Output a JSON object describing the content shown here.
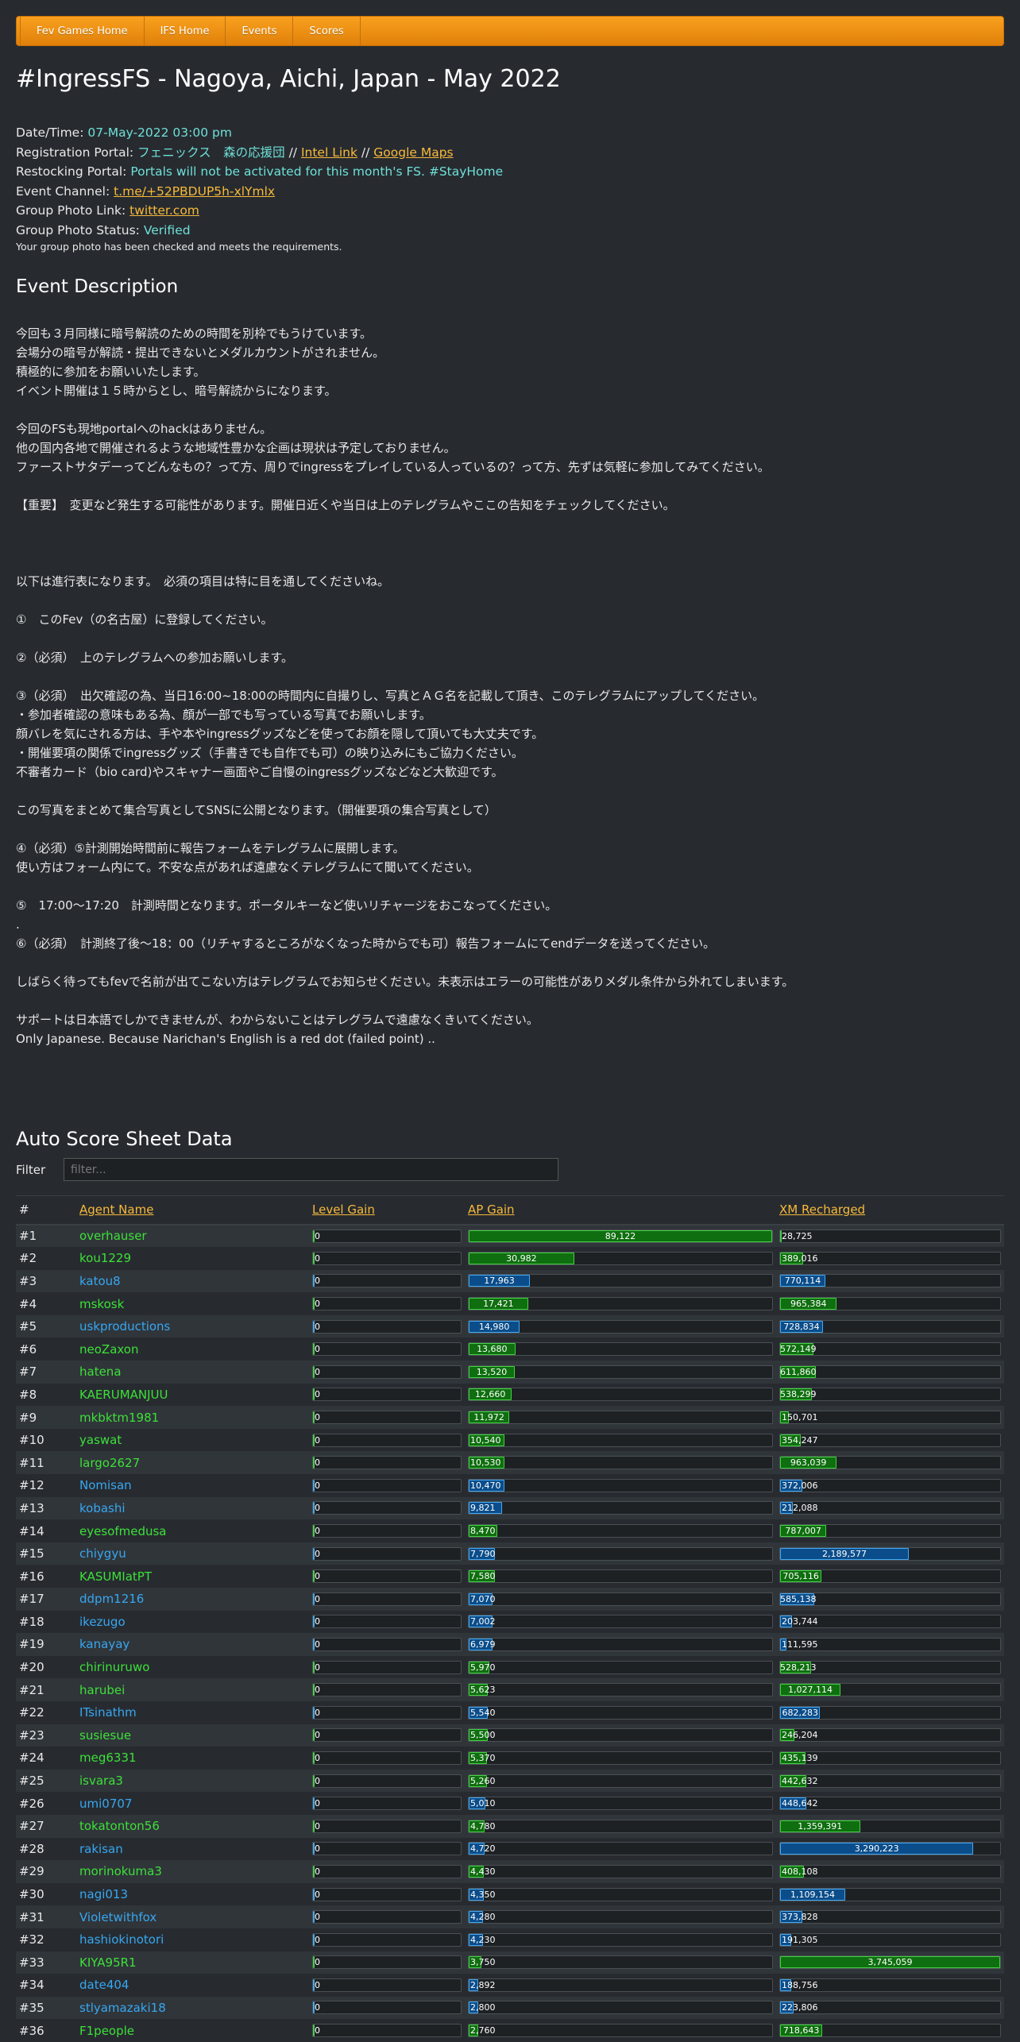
{
  "nav": [
    "Fev Games Home",
    "IFS Home",
    "Events",
    "Scores"
  ],
  "title": "#IngressFS - Nagoya, Aichi, Japan - May 2022",
  "info": {
    "datetime_label": "Date/Time:",
    "datetime_value": "07-May-2022 03:00 pm",
    "registration_label": "Registration Portal:",
    "registration_value": "フェニックス　森の応援団",
    "sep": " // ",
    "intel_link": "Intel Link",
    "google_maps": "Google Maps",
    "restocking_label": "Restocking Portal:",
    "restocking_value": "Portals will not be activated for this month's FS. #StayHome",
    "channel_label": "Event Channel:",
    "channel_value": "t.me/+52PBDUP5h-xlYmlx",
    "photo_link_label": "Group Photo Link:",
    "photo_link_value": "twitter.com",
    "photo_status_label": "Group Photo Status:",
    "photo_status_value": "Verified",
    "photo_note": "Your group photo has been checked and meets the requirements."
  },
  "description_heading": "Event Description",
  "description": "今回も３月同様に暗号解読のための時間を別枠でもうけています。\n会場分の暗号が解読・提出できないとメダルカウントがされません。\n積極的に参加をお願いいたします。\nイベント開催は１５時からとし、暗号解読からになります。\n\n今回のFSも現地portalへのhackはありません。\n他の国内各地で開催されるような地域性豊かな企画は現状は予定しておりません。\nファーストサタデーってどんなもの？って方、周りでingressをプレイしている人っているの？って方、先ずは気軽に参加してみてください。\n\n【重要】　変更など発生する可能性があります。開催日近くや当日は上のテレグラムやここの告知をチェックしてください。\n\n\n\n以下は進行表になります。　必須の項目は特に目を通してくださいね。\n\n①　このFev（の名古屋）に登録してください。\n\n②（必須）　上のテレグラムへの参加お願いします。\n\n③（必須）　出欠確認の為、当日16:00~18:00の時間内に自撮りし、写真とＡＧ名を記載して頂き、このテレグラムにアップしてください。\n・参加者確認の意味もある為、顔が一部でも写っている写真でお願いします。\n顔バレを気にされる方は、手や本やingressグッズなどを使ってお顔を隠して頂いても大丈夫です。\n・開催要項の関係でingressグッズ（手書きでも自作でも可）の映り込みにもご協力ください。\n不審者カード（bio card)やスキャナー画面やご自慢のingressグッズなどなど大歓迎です。\n\nこの写真をまとめて集合写真としてSNSに公開となります。（開催要項の集合写真として）\n\n④（必須）⑤計測開始時間前に報告フォームをテレグラムに展開します。\n使い方はフォーム内にて。不安な点があれば遠慮なくテレグラムにて聞いてください。\n\n⑤　17:00～17:20　計測時間となります。ポータルキーなど使いリチャージをおこなってください。\n.\n⑥（必須）　計測終了後～18：00（リチャするところがなくなった時からでも可）報告フォームにてendデータを送ってください。\n\nしばらく待ってもfevで名前が出てこない方はテレグラムでお知らせください。未表示はエラーの可能性がありメダル条件から外れてしまいます。\n\nサポートは日本語でしかできませんが、わからないことはテレグラムで遠慮なくきいてください。\nOnly Japanese. Because Narichan's English is a red dot (failed point) ..",
  "score_heading": "Auto Score Sheet Data",
  "filter_label": "Filter",
  "filter_placeholder": "filter...",
  "table_headers": {
    "rank": "#",
    "agent": "Agent Name",
    "level": "Level Gain",
    "ap": "AP Gain",
    "xm": "XM Recharged"
  },
  "max_ap": 89122,
  "max_xm": 3745059,
  "colors": {
    "enl": "#3de038",
    "res": "#37a7f0",
    "accent": "#f8b93a"
  },
  "rows": [
    {
      "rank": "#1",
      "agent": "overhauser",
      "faction": "enl",
      "level": "0",
      "ap": 89122,
      "ap_text": "89,122",
      "xm": 28725,
      "xm_text": "28,725"
    },
    {
      "rank": "#2",
      "agent": "kou1229",
      "faction": "enl",
      "level": "0",
      "ap": 30982,
      "ap_text": "30,982",
      "xm": 389016,
      "xm_text": "389,016"
    },
    {
      "rank": "#3",
      "agent": "katou8",
      "faction": "res",
      "level": "0",
      "ap": 17963,
      "ap_text": "17,963",
      "xm": 770114,
      "xm_text": "770,114"
    },
    {
      "rank": "#4",
      "agent": "mskosk",
      "faction": "enl",
      "level": "0",
      "ap": 17421,
      "ap_text": "17,421",
      "xm": 965384,
      "xm_text": "965,384"
    },
    {
      "rank": "#5",
      "agent": "uskproductions",
      "faction": "res",
      "level": "0",
      "ap": 14980,
      "ap_text": "14,980",
      "xm": 728834,
      "xm_text": "728,834"
    },
    {
      "rank": "#6",
      "agent": "neoZaxon",
      "faction": "enl",
      "level": "0",
      "ap": 13680,
      "ap_text": "13,680",
      "xm": 572149,
      "xm_text": "572,149"
    },
    {
      "rank": "#7",
      "agent": "hatena",
      "faction": "enl",
      "level": "0",
      "ap": 13520,
      "ap_text": "13,520",
      "xm": 611860,
      "xm_text": "611,860"
    },
    {
      "rank": "#8",
      "agent": "KAERUMANJUU",
      "faction": "enl",
      "level": "0",
      "ap": 12660,
      "ap_text": "12,660",
      "xm": 538299,
      "xm_text": "538,299"
    },
    {
      "rank": "#9",
      "agent": "mkbktm1981",
      "faction": "enl",
      "level": "0",
      "ap": 11972,
      "ap_text": "11,972",
      "xm": 150701,
      "xm_text": "150,701"
    },
    {
      "rank": "#10",
      "agent": "yaswat",
      "faction": "enl",
      "level": "0",
      "ap": 10540,
      "ap_text": "10,540",
      "xm": 354247,
      "xm_text": "354,247"
    },
    {
      "rank": "#11",
      "agent": "largo2627",
      "faction": "enl",
      "level": "0",
      "ap": 10530,
      "ap_text": "10,530",
      "xm": 963039,
      "xm_text": "963,039"
    },
    {
      "rank": "#12",
      "agent": "Nomisan",
      "faction": "res",
      "level": "0",
      "ap": 10470,
      "ap_text": "10,470",
      "xm": 372006,
      "xm_text": "372,006"
    },
    {
      "rank": "#13",
      "agent": "kobashi",
      "faction": "res",
      "level": "0",
      "ap": 9821,
      "ap_text": "9,821",
      "xm": 212088,
      "xm_text": "212,088"
    },
    {
      "rank": "#14",
      "agent": "eyesofmedusa",
      "faction": "enl",
      "level": "0",
      "ap": 8470,
      "ap_text": "8,470",
      "xm": 787007,
      "xm_text": "787,007"
    },
    {
      "rank": "#15",
      "agent": "chiygyu",
      "faction": "res",
      "level": "0",
      "ap": 7790,
      "ap_text": "7,790",
      "xm": 2189577,
      "xm_text": "2,189,577"
    },
    {
      "rank": "#16",
      "agent": "KASUMIatPT",
      "faction": "enl",
      "level": "0",
      "ap": 7580,
      "ap_text": "7,580",
      "xm": 705116,
      "xm_text": "705,116"
    },
    {
      "rank": "#17",
      "agent": "ddpm1216",
      "faction": "res",
      "level": "0",
      "ap": 7070,
      "ap_text": "7,070",
      "xm": 585138,
      "xm_text": "585,138"
    },
    {
      "rank": "#18",
      "agent": "ikezugo",
      "faction": "res",
      "level": "0",
      "ap": 7002,
      "ap_text": "7,002",
      "xm": 203744,
      "xm_text": "203,744"
    },
    {
      "rank": "#19",
      "agent": "kanayay",
      "faction": "res",
      "level": "0",
      "ap": 6979,
      "ap_text": "6,979",
      "xm": 111595,
      "xm_text": "111,595"
    },
    {
      "rank": "#20",
      "agent": "chirinuruwo",
      "faction": "enl",
      "level": "0",
      "ap": 5970,
      "ap_text": "5,970",
      "xm": 528213,
      "xm_text": "528,213"
    },
    {
      "rank": "#21",
      "agent": "harubei",
      "faction": "enl",
      "level": "0",
      "ap": 5623,
      "ap_text": "5,623",
      "xm": 1027114,
      "xm_text": "1,027,114"
    },
    {
      "rank": "#22",
      "agent": "ITsinathm",
      "faction": "res",
      "level": "0",
      "ap": 5540,
      "ap_text": "5,540",
      "xm": 682283,
      "xm_text": "682,283"
    },
    {
      "rank": "#23",
      "agent": "susiesue",
      "faction": "enl",
      "level": "0",
      "ap": 5500,
      "ap_text": "5,500",
      "xm": 246204,
      "xm_text": "246,204"
    },
    {
      "rank": "#24",
      "agent": "meg6331",
      "faction": "enl",
      "level": "0",
      "ap": 5370,
      "ap_text": "5,370",
      "xm": 435139,
      "xm_text": "435,139"
    },
    {
      "rank": "#25",
      "agent": "isvara3",
      "faction": "enl",
      "level": "0",
      "ap": 5260,
      "ap_text": "5,260",
      "xm": 442632,
      "xm_text": "442,632"
    },
    {
      "rank": "#26",
      "agent": "umi0707",
      "faction": "res",
      "level": "0",
      "ap": 5010,
      "ap_text": "5,010",
      "xm": 448642,
      "xm_text": "448,642"
    },
    {
      "rank": "#27",
      "agent": "tokatonton56",
      "faction": "enl",
      "level": "0",
      "ap": 4780,
      "ap_text": "4,780",
      "xm": 1359391,
      "xm_text": "1,359,391"
    },
    {
      "rank": "#28",
      "agent": "rakisan",
      "faction": "res",
      "level": "0",
      "ap": 4720,
      "ap_text": "4,720",
      "xm": 3290223,
      "xm_text": "3,290,223"
    },
    {
      "rank": "#29",
      "agent": "morinokuma3",
      "faction": "enl",
      "level": "0",
      "ap": 4430,
      "ap_text": "4,430",
      "xm": 408108,
      "xm_text": "408,108"
    },
    {
      "rank": "#30",
      "agent": "nagi013",
      "faction": "res",
      "level": "0",
      "ap": 4350,
      "ap_text": "4,350",
      "xm": 1109154,
      "xm_text": "1,109,154"
    },
    {
      "rank": "#31",
      "agent": "Violetwithfox",
      "faction": "res",
      "level": "0",
      "ap": 4280,
      "ap_text": "4,280",
      "xm": 373828,
      "xm_text": "373,828"
    },
    {
      "rank": "#32",
      "agent": "hashiokinotori",
      "faction": "res",
      "level": "0",
      "ap": 4230,
      "ap_text": "4,230",
      "xm": 191305,
      "xm_text": "191,305"
    },
    {
      "rank": "#33",
      "agent": "KIYA95R1",
      "faction": "enl",
      "level": "0",
      "ap": 3750,
      "ap_text": "3,750",
      "xm": 3745059,
      "xm_text": "3,745,059"
    },
    {
      "rank": "#34",
      "agent": "date404",
      "faction": "res",
      "level": "0",
      "ap": 2892,
      "ap_text": "2,892",
      "xm": 188756,
      "xm_text": "188,756"
    },
    {
      "rank": "#35",
      "agent": "stlyamazaki18",
      "faction": "res",
      "level": "0",
      "ap": 2800,
      "ap_text": "2,800",
      "xm": 223806,
      "xm_text": "223,806"
    },
    {
      "rank": "#36",
      "agent": "F1people",
      "faction": "enl",
      "level": "0",
      "ap": 2760,
      "ap_text": "2,760",
      "xm": 718643,
      "xm_text": "718,643"
    }
  ]
}
